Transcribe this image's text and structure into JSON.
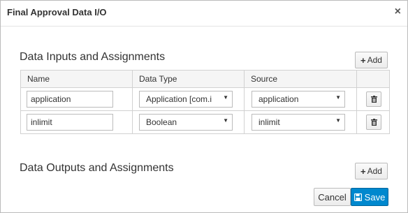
{
  "dialog": {
    "title": "Final Approval Data I/O",
    "close_glyph": "×"
  },
  "inputs": {
    "title": "Data Inputs and Assignments",
    "add_label": "Add",
    "columns": {
      "name": "Name",
      "data_type": "Data Type",
      "source": "Source"
    },
    "rows": [
      {
        "name": "application",
        "data_type": "Application [com.i",
        "source": "application"
      },
      {
        "name": "inlimit",
        "data_type": "Boolean",
        "source": "inlimit"
      }
    ]
  },
  "outputs": {
    "title": "Data Outputs and Assignments",
    "add_label": "Add"
  },
  "footer": {
    "cancel_label": "Cancel",
    "save_label": "Save"
  },
  "icons": {
    "add": "plus-icon",
    "delete": "trash-icon",
    "save": "floppy-disk-icon",
    "close": "close-icon",
    "dropdown": "caret-down-icon"
  },
  "colors": {
    "primary": "#0088ce",
    "header_bg": "#f5f5f5"
  }
}
